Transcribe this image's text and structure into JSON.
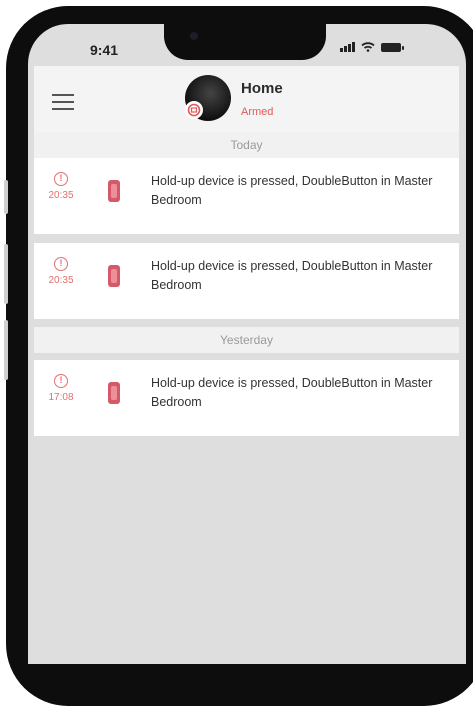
{
  "status_bar": {
    "time": "9:41"
  },
  "header": {
    "title": "Home",
    "status": "Armed"
  },
  "sections": [
    {
      "label": "Today",
      "events": [
        {
          "time": "20:35",
          "text": "Hold-up device is pressed, DoubleButton in Master Bedroom"
        },
        {
          "time": "20:35",
          "text": "Hold-up device is pressed, DoubleButton in Master Bedroom"
        }
      ]
    },
    {
      "label": "Yesterday",
      "events": [
        {
          "time": "17:08",
          "text": "Hold-up device is pressed, DoubleButton in Master Bedroom"
        }
      ]
    }
  ],
  "colors": {
    "accent": "#e05a5a",
    "device": "#d45a6a",
    "background": "#dedede"
  },
  "icons": {
    "event": "alert-circle-icon",
    "device": "double-button-icon",
    "menu": "hamburger-menu-icon",
    "armed": "armed-shield-icon"
  }
}
